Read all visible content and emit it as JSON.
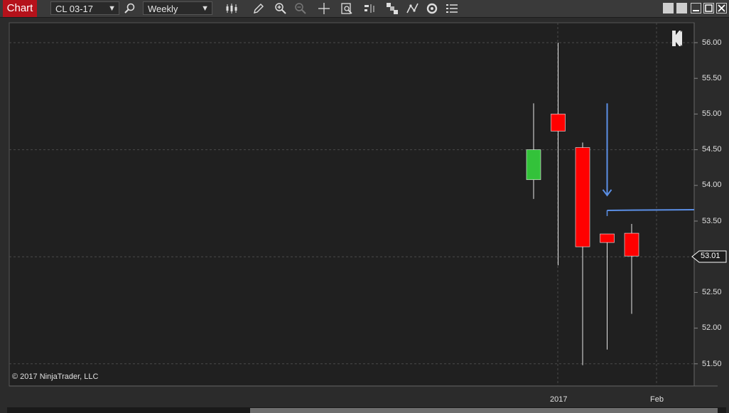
{
  "toolbar": {
    "chart_tab": "Chart",
    "instrument": "CL 03-17",
    "period": "Weekly"
  },
  "chart": {
    "price_marker": "53.01",
    "copyright": "© 2017 NinjaTrader, LLC",
    "y_tick_labels": [
      "56.00",
      "55.50",
      "55.00",
      "54.50",
      "54.00",
      "53.50",
      "53.01",
      "52.50",
      "52.00",
      "51.50"
    ],
    "x_tick_labels": [
      "2017",
      "Feb"
    ]
  },
  "chart_data": {
    "type": "candlestick",
    "title": "",
    "xlabel": "",
    "ylabel": "",
    "ylim": [
      51.3,
      56.25
    ],
    "y_ticks": [
      51.5,
      52.0,
      52.5,
      53.0,
      53.5,
      54.0,
      54.5,
      55.0,
      55.5,
      56.0
    ],
    "x_ticks": [
      "2017",
      "Feb"
    ],
    "grid": true,
    "colors": {
      "up": "#33c23a",
      "down": "#ff0000",
      "background": "#202020",
      "annotation": "#5b8fe6"
    },
    "candles": [
      {
        "open": 54.08,
        "high": 55.15,
        "low": 53.81,
        "close": 54.5
      },
      {
        "open": 55.0,
        "high": 56.0,
        "low": 52.88,
        "close": 54.76
      },
      {
        "open": 54.53,
        "high": 54.6,
        "low": 51.48,
        "close": 53.14
      },
      {
        "open": 53.32,
        "high": 53.32,
        "low": 51.7,
        "close": 53.2
      },
      {
        "open": 53.33,
        "high": 53.46,
        "low": 52.2,
        "close": 53.01
      }
    ],
    "last_price": 53.01,
    "annotations": [
      {
        "type": "down-arrow",
        "at_candle": 3,
        "from": 55.15,
        "to": 53.92
      },
      {
        "type": "horizontal-line",
        "from_candle": 3,
        "value": 53.65
      }
    ]
  }
}
